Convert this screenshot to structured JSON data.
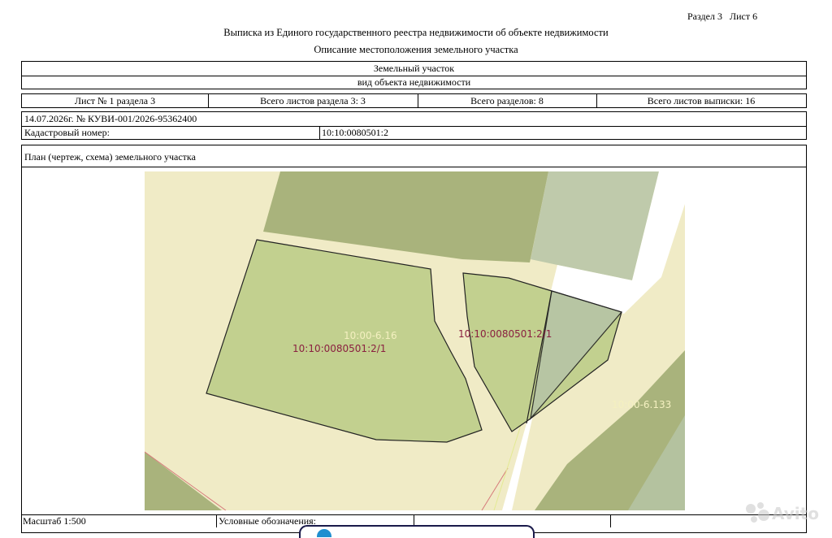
{
  "header": {
    "section_label": "Раздел 3   Лист 6",
    "title": "Выписка из Единого государственного реестра недвижимости об объекте недвижимости",
    "subtitle": "Описание местоположения земельного участка"
  },
  "object": {
    "type": "Земельный участок",
    "type_caption": "вид объекта недвижимости"
  },
  "sheet_info": {
    "sheet": "Лист № 1 раздела 3",
    "total_section_sheets": "Всего листов раздела 3: 3",
    "total_sections": "Всего разделов: 8",
    "total_extract_sheets": "Всего листов выписки: 16"
  },
  "record": {
    "date_number": "14.07.2026г. № КУВИ-001/2026-95362400",
    "cadastral_label": "Кадастровый номер:",
    "cadastral_value": "10:10:0080501:2"
  },
  "plan": {
    "title": "План (чертеж, схема) земельного участка",
    "labels": {
      "zone_main": "10:00-6.16",
      "parcel_main": "10:10:0080501:2/1",
      "parcel_right": "10:10:0080501:2/1",
      "zone_right": "10:00-6.133"
    },
    "colors": {
      "background": "#f0ebc6",
      "parcel": "#c2d08f",
      "forest": "#a9b37c",
      "gray_zone": "#b6c4a6"
    }
  },
  "footer": {
    "scale": "Масштаб 1:500",
    "legend": "Условные обозначения:"
  },
  "watermark": {
    "text": "Avito"
  }
}
